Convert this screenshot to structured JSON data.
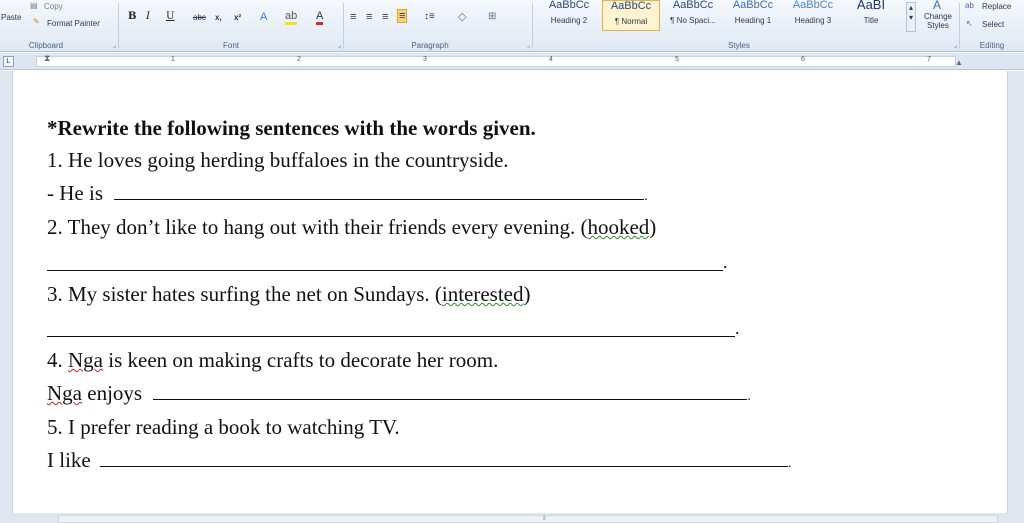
{
  "ribbon": {
    "clipboard": {
      "paste": "Paste",
      "copy": "Copy",
      "format_painter": "Format Painter",
      "label": "Clipboard"
    },
    "font": {
      "bold": "B",
      "italic": "I",
      "underline": "U",
      "strike": "abc",
      "subscript": "x,",
      "superscript": "x²",
      "label": "Font"
    },
    "paragraph": {
      "label": "Paragraph"
    },
    "styles": {
      "label": "Styles",
      "items": [
        {
          "sample": "AaBbCc",
          "name": "Heading 2"
        },
        {
          "sample": "AaBbCc",
          "name": "¶ Normal"
        },
        {
          "sample": "AaBbCc",
          "name": "¶ No Spaci..."
        },
        {
          "sample": "AaBbCc",
          "name": "Heading 1"
        },
        {
          "sample": "AaBbCc",
          "name": "Heading 3"
        },
        {
          "sample": "AaBI",
          "name": "Title"
        }
      ],
      "change_styles": "Change Styles"
    },
    "editing": {
      "replace": "Replace",
      "select": "Select",
      "label": "Editing"
    }
  },
  "ruler": {
    "numbers": [
      "1",
      "2",
      "3",
      "4",
      "5",
      "6",
      "7"
    ]
  },
  "document": {
    "heading": "*Rewrite the following sentences with the words given.",
    "q1": "1. He loves going herding buffaloes in the countryside.",
    "q1_answer_prefix": "- He is",
    "q2_before": "2. They don’t like to hang out with their friends every evening. (",
    "q2_word": "hooked",
    "q2_after": ")",
    "q3_before": "3. My sister hates surfing the net on Sundays. (",
    "q3_word": "interested",
    "q3_after": ")",
    "q4_before": "4. ",
    "q4_name": "Nga",
    "q4_after": " is keen on making crafts to decorate her room.",
    "q4_answer_name": "Nga",
    "q4_answer_rest": " enjoys",
    "q5": "5. I prefer reading a book to watching TV.",
    "q5_answer_prefix": "I like",
    "period": "."
  }
}
